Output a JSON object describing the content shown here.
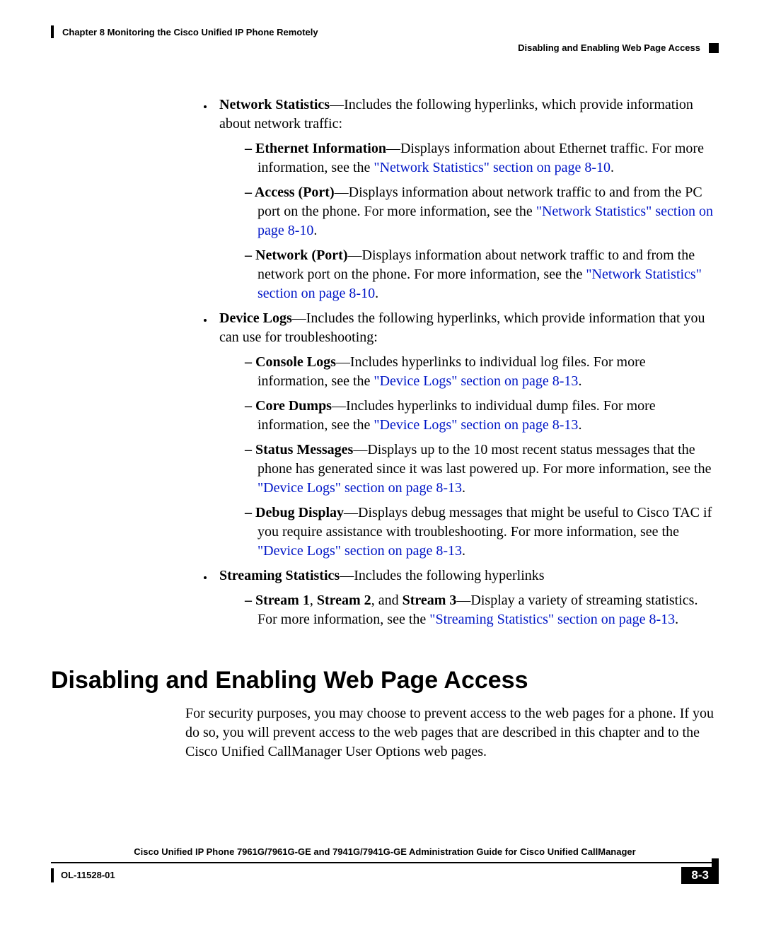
{
  "header": {
    "chapter": "Chapter 8      Monitoring the Cisco Unified IP Phone Remotely",
    "section": "Disabling and Enabling Web Page Access"
  },
  "bullets": {
    "netstats": {
      "lead": "Network Statistics",
      "text": "—Includes the following hyperlinks, which provide information about network traffic:",
      "items": {
        "eth": {
          "lead": "Ethernet Information",
          "t1": "—Displays information about Ethernet traffic. For more information, see the ",
          "link": "\"Network Statistics\" section on page 8-10",
          "t2": "."
        },
        "access": {
          "lead": "Access (Port)",
          "t1": "—Displays information about network traffic to and from the PC port on the phone. For more information, see the ",
          "link": "\"Network Statistics\" section on page 8-10",
          "t2": "."
        },
        "netport": {
          "lead": "Network (Port)",
          "t1": "—Displays information about network traffic to and from the network port on the phone. For more information, see the ",
          "link": "\"Network Statistics\" section on page 8-10",
          "t2": "."
        }
      }
    },
    "devlogs": {
      "lead": "Device Logs",
      "text": "—Includes the following hyperlinks, which provide information that you can use for troubleshooting:",
      "items": {
        "console": {
          "lead": "Console Logs",
          "t1": "—Includes hyperlinks to individual log files. For more information, see the ",
          "link": "\"Device Logs\" section on page 8-13",
          "t2": "."
        },
        "core": {
          "lead": "Core Dumps",
          "t1": "—Includes hyperlinks to individual dump files. For more information, see the ",
          "link": "\"Device Logs\" section on page 8-13",
          "t2": "."
        },
        "status": {
          "lead": "Status Messages",
          "t1": "—Displays up to the 10 most recent status messages that the phone has generated since it was last powered up. For more information, see the ",
          "link": "\"Device Logs\" section on page 8-13",
          "t2": "."
        },
        "debug": {
          "lead": "Debug Display",
          "t1": "—Displays debug messages that might be useful to Cisco TAC if you require assistance with troubleshooting. For more information, see the ",
          "link": "\"Device Logs\" section on page 8-13",
          "t2": "."
        }
      }
    },
    "stream": {
      "lead": "Streaming Statistics",
      "text": "—Includes the following hyperlinks",
      "items": {
        "streams": {
          "l1": "Stream 1",
          "l2": "Stream 2",
          "l3": "Stream 3",
          "c": ", ",
          "and": ", and ",
          "t1": "—Display a variety of streaming statistics. For more information, see the ",
          "link": "\"Streaming Statistics\" section on page 8-13",
          "t2": "."
        }
      }
    }
  },
  "section": {
    "title": "Disabling and Enabling Web Page Access",
    "body": "For security purposes, you may choose to prevent access to the web pages for a phone. If you do so, you will prevent access to the web pages that are described in this chapter and to the Cisco Unified CallManager User Options web pages."
  },
  "footer": {
    "title": "Cisco Unified IP Phone 7961G/7961G-GE and 7941G/7941G-GE Administration Guide for Cisco Unified CallManager",
    "docid": "OL-11528-01",
    "page": "8-3"
  }
}
